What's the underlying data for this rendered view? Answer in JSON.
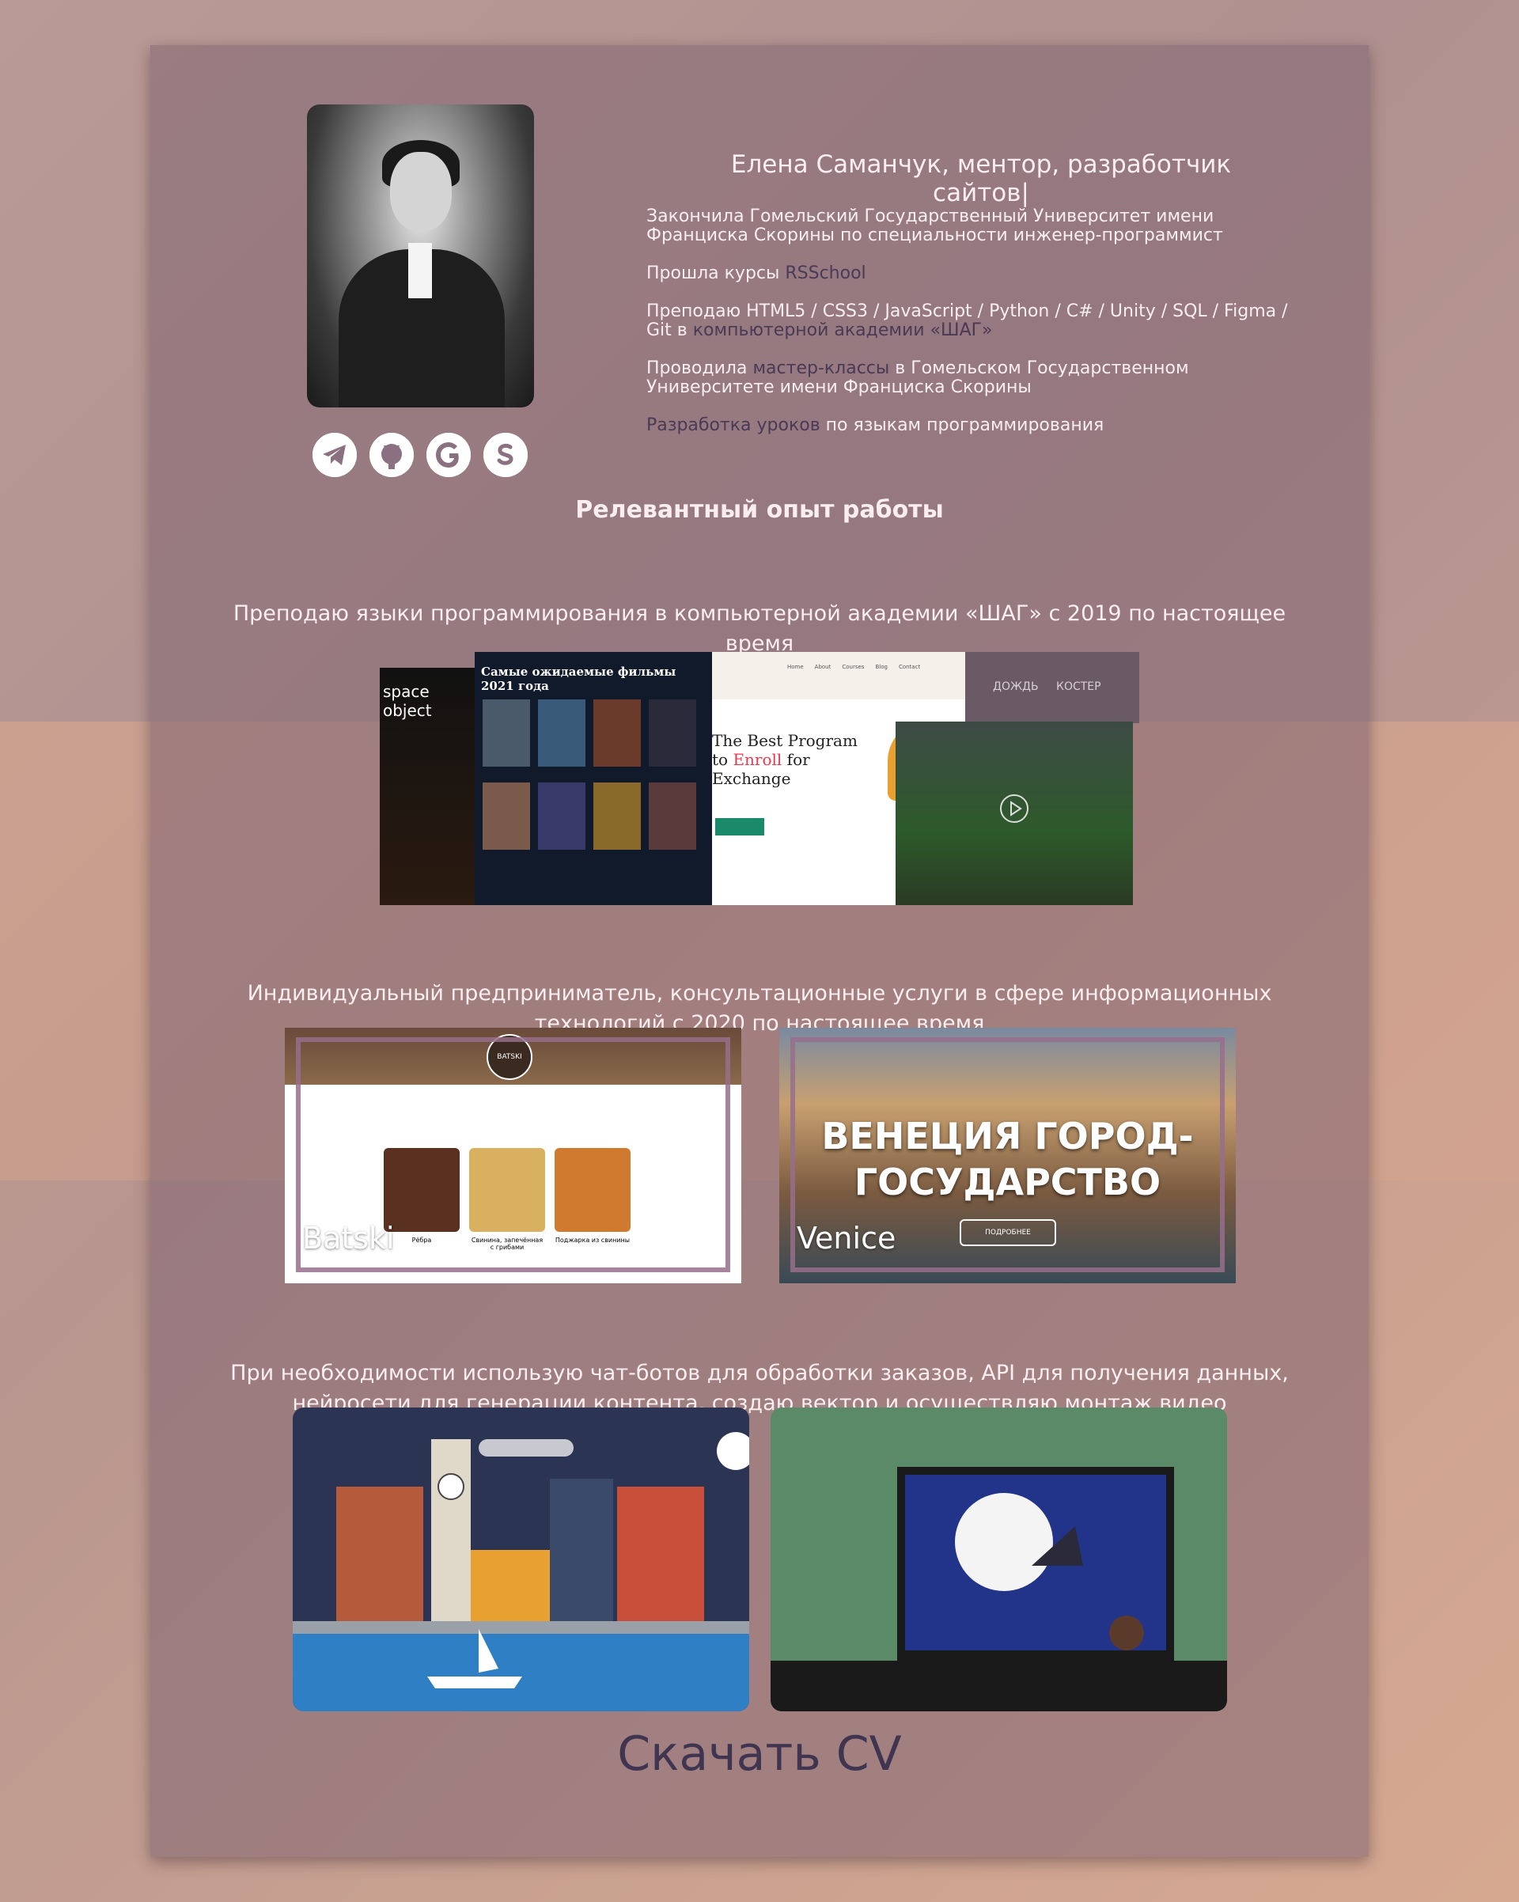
{
  "header": {
    "headline": "Елена Саманчук, ментор, разработчик сайтов|"
  },
  "bio": [
    {
      "pre": "Закончила Гомельский Государственный Университет имени Франциска Скорины по специальности инженер-программист",
      "link": "",
      "post": ""
    },
    {
      "pre": "Прошла курсы ",
      "link": "RSSchool",
      "post": ""
    },
    {
      "pre": "Преподаю HTML5 / CSS3 / JavaScript / Python / C# / Unity / SQL / Figma / Git в ",
      "link": "компьютерной академии «ШАГ»",
      "post": ""
    },
    {
      "pre": "Проводила ",
      "link": "мастер-классы",
      "post": " в Гомельском Государственном Университете имени Франциска Скорины"
    },
    {
      "pre": "",
      "link": "Разработка уроков",
      "post": " по языкам программирования"
    }
  ],
  "socials": [
    "telegram-icon",
    "github-icon",
    "google-icon",
    "skype-icon"
  ],
  "section_title": "Релевантный опыт работы",
  "experience": {
    "teaching": "Преподаю языки программирования в компьютерной академии «ШАГ» с 2019 по настоящее время",
    "entrepreneur": "Индивидуальный предприниматель, консультационные услуги в сфере информационных технологий с 2020 по настоящее время",
    "tools": "При необходимости использую чат-ботов для обработки заказов, API для получения данных, нейросети для генерации контента, создаю вектор и осуществляю монтаж видео"
  },
  "collage": {
    "space_label": "space object",
    "movies_title": "Самые ожидаемые фильмы 2021 года",
    "landing_title_1": "The Best Program",
    "landing_title_2a": "to ",
    "landing_title_2b": "Enroll",
    "landing_title_2c": " for",
    "landing_title_3": "Exchange",
    "landing_nav": [
      "Home",
      "About",
      "Courses",
      "Blog",
      "Contact"
    ],
    "music_tabs": [
      "ДОЖДЬ",
      "КОСТЕР"
    ]
  },
  "projects": [
    {
      "caption": "Batski",
      "logo": "BATSKI",
      "items": [
        "Рёбра",
        "Свинина, запечённая с грибами",
        "Поджарка из свинины"
      ]
    },
    {
      "caption": "Venice",
      "title_1": "ВЕНЕЦИЯ ГОРОД-",
      "title_2": "ГОСУДАРСТВО",
      "button": "ПОДРОБНЕЕ"
    }
  ],
  "cv": {
    "label": "Скачать CV"
  },
  "colors": {
    "accent_link": "#4a3a55",
    "text_light": "#fbeef0",
    "cv": "#3f3550"
  }
}
